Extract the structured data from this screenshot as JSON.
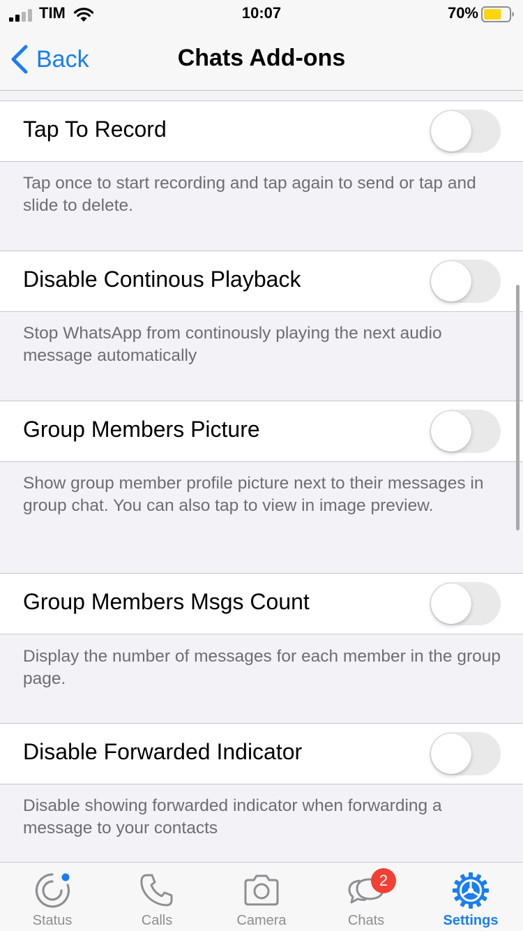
{
  "status_bar": {
    "carrier": "TIM",
    "time": "10:07",
    "battery_percent": "70%",
    "battery_level": 0.7,
    "battery_color": "#ffd60a"
  },
  "nav": {
    "back_label": "Back",
    "title": "Chats Add-ons",
    "accent_color": "#1a7ef0"
  },
  "settings": [
    {
      "label": "Tap To Record",
      "enabled": false,
      "description": "Tap once to start recording and tap again to send or tap and slide to delete."
    },
    {
      "label": "Disable Continous Playback",
      "enabled": false,
      "description": "Stop WhatsApp from continously playing the next audio message automatically"
    },
    {
      "label": "Group Members Picture",
      "enabled": false,
      "description": "Show group member profile picture next to their messages in group chat. You can also tap to view in image preview."
    },
    {
      "label": "Group Members Msgs Count",
      "enabled": false,
      "description": "Display the number of messages for each member in the group page."
    },
    {
      "label": "Disable Forwarded Indicator",
      "enabled": false,
      "description": "Disable showing forwarded indicator when forwarding a message to your contacts"
    }
  ],
  "tab_bar": {
    "tabs": [
      {
        "label": "Status",
        "icon": "status-icon"
      },
      {
        "label": "Calls",
        "icon": "phone-icon"
      },
      {
        "label": "Camera",
        "icon": "camera-icon"
      },
      {
        "label": "Chats",
        "icon": "chat-bubbles-icon",
        "badge": "2"
      },
      {
        "label": "Settings",
        "icon": "gear-icon",
        "active": true
      }
    ]
  }
}
